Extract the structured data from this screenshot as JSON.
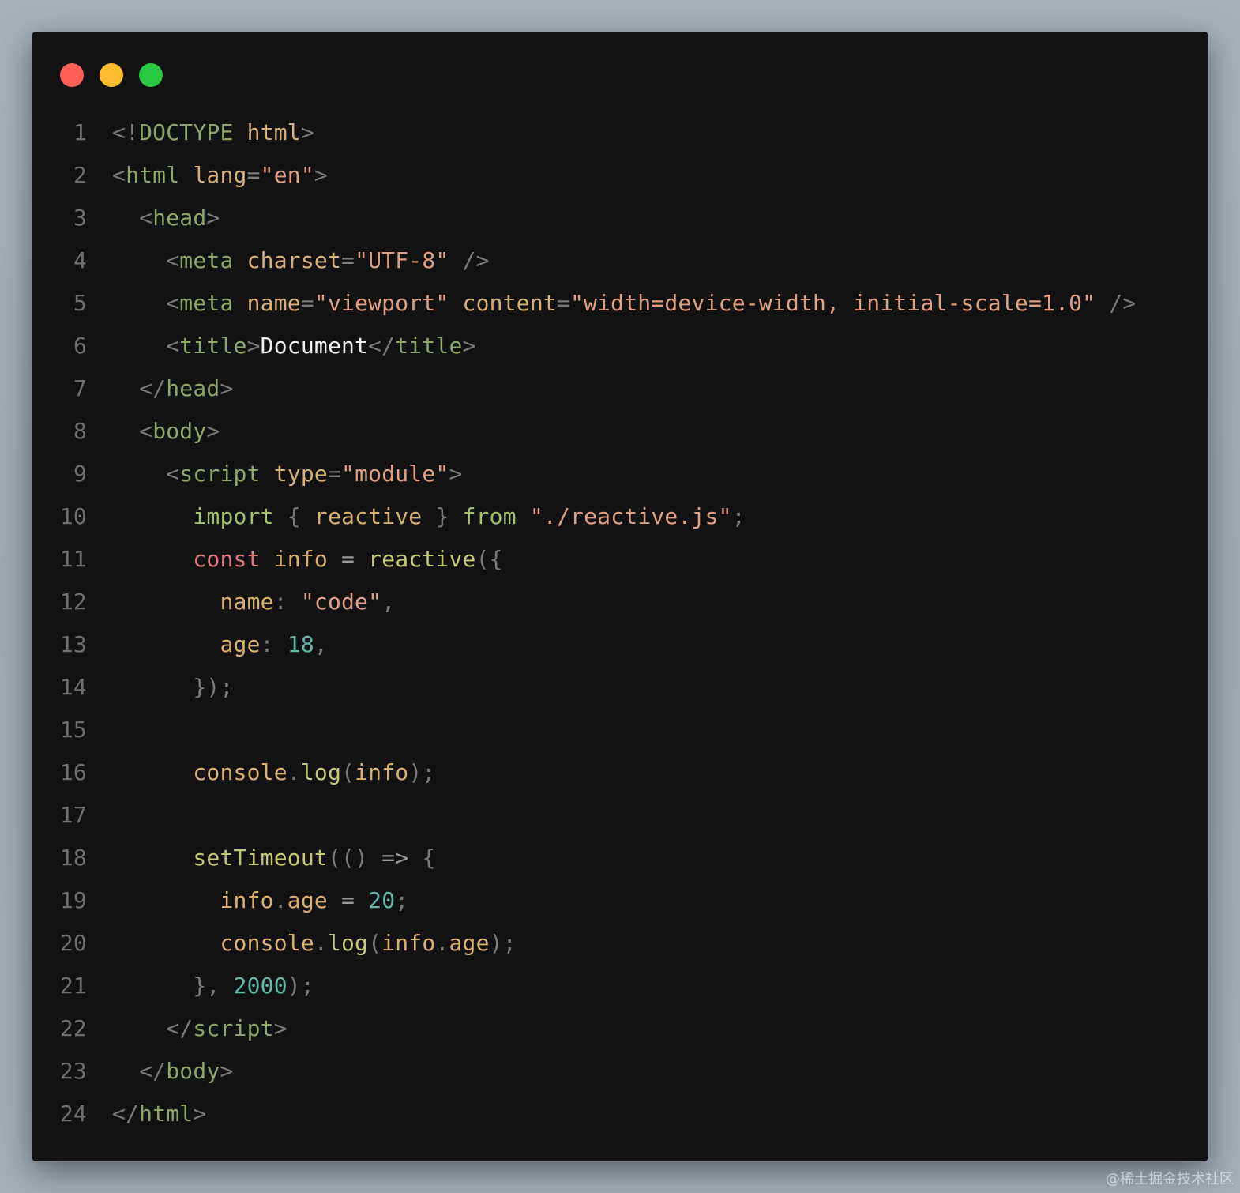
{
  "window": {
    "buttons": [
      "close",
      "minimize",
      "maximize"
    ],
    "colors": {
      "close": "#fe5f57",
      "minimize": "#febc2e",
      "maximize": "#28c840",
      "background": "#121212"
    }
  },
  "code": {
    "lines": [
      {
        "n": "1"
      },
      {
        "n": "2"
      },
      {
        "n": "3"
      },
      {
        "n": "4"
      },
      {
        "n": "5"
      },
      {
        "n": "6"
      },
      {
        "n": "7"
      },
      {
        "n": "8"
      },
      {
        "n": "9"
      },
      {
        "n": "10"
      },
      {
        "n": "11"
      },
      {
        "n": "12"
      },
      {
        "n": "13"
      },
      {
        "n": "14"
      },
      {
        "n": "15"
      },
      {
        "n": "16"
      },
      {
        "n": "17"
      },
      {
        "n": "18"
      },
      {
        "n": "19"
      },
      {
        "n": "20"
      },
      {
        "n": "21"
      },
      {
        "n": "22"
      },
      {
        "n": "23"
      },
      {
        "n": "24"
      }
    ],
    "l1": {
      "open": "<!",
      "doctype": "DOCTYPE",
      "html": "html",
      "close": ">"
    },
    "l2": {
      "open": "<",
      "tag": "html",
      "attr": "lang",
      "eq": "=",
      "val": "\"en\"",
      "close": ">"
    },
    "l3": {
      "indent": "  ",
      "open": "<",
      "tag": "head",
      "close": ">"
    },
    "l4": {
      "indent": "    ",
      "open": "<",
      "tag": "meta",
      "attr": "charset",
      "eq": "=",
      "val": "\"UTF-8\"",
      "close": "/>"
    },
    "l5": {
      "indent": "    ",
      "open": "<",
      "tag": "meta",
      "attr1": "name",
      "eq1": "=",
      "val1": "\"viewport\"",
      "attr2": "content",
      "eq2": "=",
      "val2": "\"width=device-width, initial-scale=1.0\"",
      "close": "/>"
    },
    "l6": {
      "indent": "    ",
      "open": "<",
      "tag": "title",
      "close1": ">",
      "text": "Document",
      "open2": "</",
      "tag2": "title",
      "close2": ">"
    },
    "l7": {
      "indent": "  ",
      "open": "</",
      "tag": "head",
      "close": ">"
    },
    "l8": {
      "indent": "  ",
      "open": "<",
      "tag": "body",
      "close": ">"
    },
    "l9": {
      "indent": "    ",
      "open": "<",
      "tag": "script",
      "attr": "type",
      "eq": "=",
      "val": "\"module\"",
      "close": ">"
    },
    "l10": {
      "indent": "      ",
      "import": "import",
      "lb": "{",
      "name": "reactive",
      "rb": "}",
      "from": "from",
      "path": "\"./reactive.js\"",
      "semi": ";"
    },
    "l11": {
      "indent": "      ",
      "const": "const",
      "var": "info",
      "eq": "=",
      "fn": "reactive",
      "paren": "({"
    },
    "l12": {
      "indent": "        ",
      "key": "name",
      "colon": ":",
      "val": "\"code\"",
      "comma": ","
    },
    "l13": {
      "indent": "        ",
      "key": "age",
      "colon": ":",
      "val": "18",
      "comma": ","
    },
    "l14": {
      "indent": "      ",
      "close": "});"
    },
    "l15": {
      "text": ""
    },
    "l16": {
      "indent": "      ",
      "obj": "console",
      "dot": ".",
      "fn": "log",
      "lp": "(",
      "arg": "info",
      "rp": ");"
    },
    "l17": {
      "text": ""
    },
    "l18": {
      "indent": "      ",
      "fn": "setTimeout",
      "p": "(() ",
      "arrow": "=>",
      "brace": " {"
    },
    "l19": {
      "indent": "        ",
      "obj": "info",
      "dot": ".",
      "prop": "age",
      "eq": "=",
      "val": "20",
      "semi": ";"
    },
    "l20": {
      "indent": "        ",
      "obj": "console",
      "dot": ".",
      "fn": "log",
      "lp": "(",
      "arg1": "info",
      "dot2": ".",
      "arg2": "age",
      "rp": ");"
    },
    "l21": {
      "indent": "      ",
      "close": "}, ",
      "val": "2000",
      "end": ");"
    },
    "l22": {
      "indent": "    ",
      "open": "</",
      "tag": "script",
      "close": ">"
    },
    "l23": {
      "indent": "  ",
      "open": "</",
      "tag": "body",
      "close": ">"
    },
    "l24": {
      "open": "</",
      "tag": "html",
      "close": ">"
    }
  },
  "watermark": "@稀土掘金技术社区"
}
